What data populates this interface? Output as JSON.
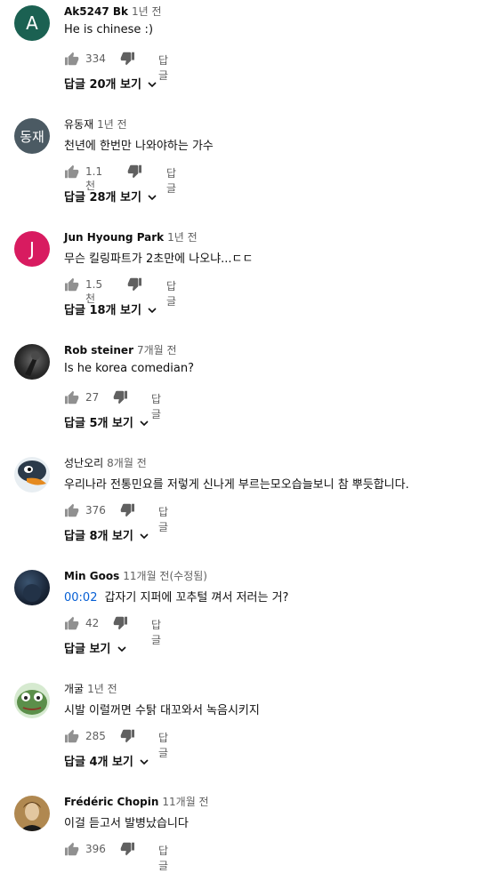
{
  "comments": [
    {
      "author": "Ak5247 Bk",
      "time": "1년 전",
      "text": "He is chinese :)",
      "timestamp": "",
      "likes": "334",
      "reply": "답글",
      "replies": "답글 20개 보기",
      "avatar_letter": "A",
      "avatar_color": "#1b6152"
    },
    {
      "author": "유동재",
      "time": "1년 전",
      "text": "천년에 한번만 나와야하는 가수",
      "timestamp": "",
      "likes": "1.1천",
      "reply": "답글",
      "replies": "답글 28개 보기",
      "avatar_letter": "동재",
      "avatar_color": "#4b5a63"
    },
    {
      "author": "Jun Hyoung Park",
      "time": "1년 전",
      "text": "무슨 킬링파트가 2초만에 나오냐...ㄷㄷ",
      "timestamp": "",
      "likes": "1.5천",
      "reply": "답글",
      "replies": "답글 18개 보기",
      "avatar_letter": "J",
      "avatar_color": "#d81b60"
    },
    {
      "author": "Rob steiner",
      "time": "7개월 전",
      "text": "Is he korea comedian?",
      "timestamp": "",
      "likes": "27",
      "reply": "답글",
      "replies": "답글 5개 보기",
      "avatar_letter": "",
      "avatar_color": "#3a3a3a"
    },
    {
      "author": "성난오리",
      "time": "8개월 전",
      "text": "우리나라 전통민요를 저렇게 신나게 부르는모오습늘보니 참 뿌듯합니다.",
      "timestamp": "",
      "likes": "376",
      "reply": "답글",
      "replies": "답글 8개 보기",
      "avatar_letter": "",
      "avatar_color": "#e8eef2"
    },
    {
      "author": "Min Goos",
      "time": "11개월 전(수정됨)",
      "text": "갑자기 지퍼에 꼬추털 껴서 저러는 거?",
      "timestamp": "00:02",
      "likes": "42",
      "reply": "답글",
      "replies": "답글 보기",
      "avatar_letter": "",
      "avatar_color": "#1e2a3a"
    },
    {
      "author": "개굴",
      "time": "1년 전",
      "text": "시발 이럴꺼면 수탉 대꼬와서 녹음시키지",
      "timestamp": "",
      "likes": "285",
      "reply": "답글",
      "replies": "답글 4개 보기",
      "avatar_letter": "",
      "avatar_color": "#5b8f4a"
    },
    {
      "author": "Frédéric Chopin",
      "time": "11개월 전",
      "text": "이걸 듣고서 발병났습니다",
      "timestamp": "",
      "likes": "396",
      "reply": "답글",
      "replies": "",
      "avatar_letter": "",
      "avatar_color": "#8a6a3a"
    }
  ]
}
